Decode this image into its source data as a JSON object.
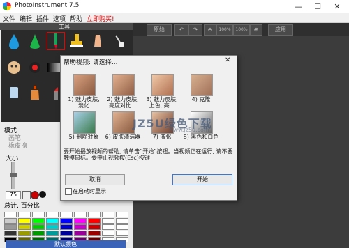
{
  "window": {
    "title": "PhotoInstrument 7.5",
    "min": "—",
    "max": "☐",
    "close": "✕"
  },
  "menu": {
    "items": [
      "文件",
      "编辑",
      "插件",
      "选项",
      "帮助"
    ],
    "promo": "立即购买!"
  },
  "tools": {
    "header": "工具"
  },
  "mode": {
    "label": "模式",
    "opt1": "画笔",
    "opt2": "橡皮擦"
  },
  "size": {
    "label": "大小",
    "value": "75"
  },
  "transparency": {
    "label": "总计, 百分比"
  },
  "colors": {
    "button": "默认颜色",
    "palette": [
      [
        "#ffffff",
        "#ffffff",
        "#ffffff",
        "#ffffff",
        "#ffffff",
        "#ffffff",
        "#ffffff",
        "#ffffff",
        "#ffffff"
      ],
      [
        "#cccccc",
        "#ffff00",
        "#00ff00",
        "#00ffff",
        "#0000ff",
        "#ff00ff",
        "#ff0000",
        "#ffffff",
        "#ffffff"
      ],
      [
        "#999999",
        "#cccc00",
        "#00cc00",
        "#00cccc",
        "#0000cc",
        "#cc00cc",
        "#cc0000",
        "#ffffff",
        "#ffffff"
      ],
      [
        "#333333",
        "#999900",
        "#009900",
        "#009999",
        "#000099",
        "#990099",
        "#990000",
        "#ffffff",
        "#ffffff"
      ],
      [
        "#000000",
        "#666600",
        "#006600",
        "#006666",
        "#000066",
        "#660066",
        "#660000",
        "#ffffff",
        "#ffffff"
      ]
    ]
  },
  "toolbar": {
    "reset": "原始",
    "zoom": "100%",
    "zoom2": "100%",
    "apply": "应用"
  },
  "dialog": {
    "title": "帮助视频: 请选择...",
    "videos": [
      {
        "label1": "1) 魅力皮肤,",
        "label2": "淡化"
      },
      {
        "label1": "2) 魅力皮肤,",
        "label2": "亮度对比..."
      },
      {
        "label1": "3) 魅力皮肤,",
        "label2": "上色, 亮..."
      },
      {
        "label1": "4) 克隆",
        "label2": ""
      },
      {
        "label1": "5) 删除对象",
        "label2": ""
      },
      {
        "label1": "6) 皮肤清洁器",
        "label2": ""
      },
      {
        "label1": "7) 液化",
        "label2": ""
      },
      {
        "label1": "8) 黑色和白色",
        "label2": ""
      }
    ],
    "info": "要开始播放视频的帮助, 请单击“开始”按钮。当视频正在运行, 请不要触摸鼠标。要中止视频按(Esc)按键",
    "cancel": "取消",
    "start": "开始",
    "show_on_startup": "在启动时显示"
  },
  "watermark": {
    "text": "JZ5U绿色下载",
    "url": "www.jz5u.com"
  }
}
